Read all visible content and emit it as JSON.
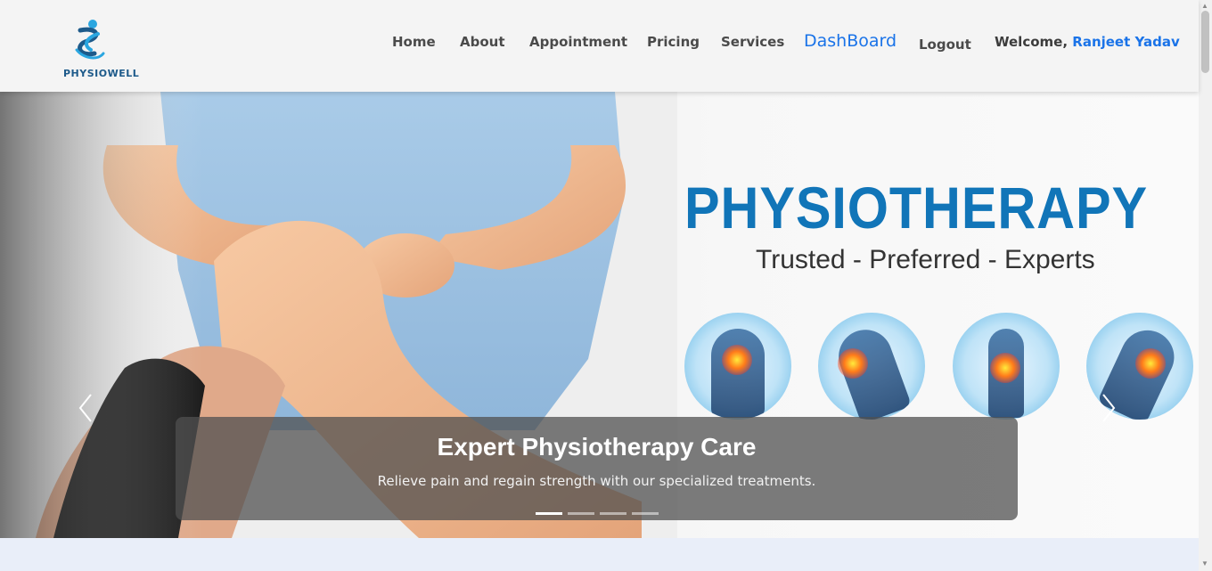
{
  "brand": {
    "name": "PHYSIOWELL"
  },
  "nav": {
    "home": "Home",
    "about": "About",
    "appointment": "Appointment",
    "pricing": "Pricing",
    "services": "Services",
    "dashboard": "DashBoard",
    "logout": "Logout"
  },
  "user": {
    "welcome": "Welcome,",
    "name": "Ranjeet Yadav"
  },
  "hero": {
    "title": "PHYSIOTHERAPY",
    "tagline": "Trusted - Preferred - Experts",
    "caption_title": "Expert Physiotherapy Care",
    "caption_text": "Relieve pain and regain strength with our specialized treatments.",
    "slide_count": 4,
    "active_slide": 1
  },
  "colors": {
    "accent": "#1a73e8",
    "brand": "#1175b8",
    "nav_text": "#4a4a4a"
  }
}
